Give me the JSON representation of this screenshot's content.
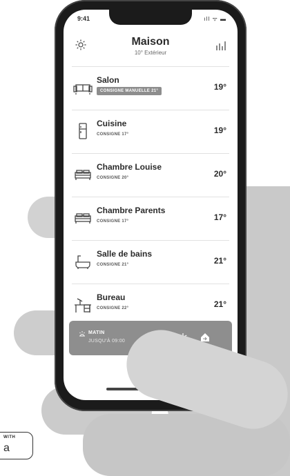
{
  "status_bar": {
    "time": "9:41",
    "icons": "ıll ᯤ ▬"
  },
  "header": {
    "title": "Maison",
    "subtitle": "10° Extérieur"
  },
  "rooms": [
    {
      "name": "Salon",
      "setpoint": "CONSIGNE MANUELLE 21°",
      "temp": "19°",
      "icon": "sofa-icon",
      "manual": true
    },
    {
      "name": "Cuisine",
      "setpoint": "CONSIGNE 17°",
      "temp": "19°",
      "icon": "fridge-icon"
    },
    {
      "name": "Chambre Louise",
      "setpoint": "CONSIGNE 20°",
      "temp": "20°",
      "icon": "bed-icon"
    },
    {
      "name": "Chambre Parents",
      "setpoint": "CONSIGNE 17°",
      "temp": "17°",
      "icon": "bed-icon"
    },
    {
      "name": "Salle de bains",
      "setpoint": "CONSIGNE 21°",
      "temp": "21°",
      "icon": "bathtub-icon"
    },
    {
      "name": "Bureau",
      "setpoint": "CONSIGNE 22°",
      "temp": "21°",
      "icon": "desk-icon"
    }
  ],
  "mode": {
    "name": "MATIN",
    "until": "JUSQU'À 09:00"
  },
  "badge": {
    "small": "WITH",
    "big": "a"
  }
}
